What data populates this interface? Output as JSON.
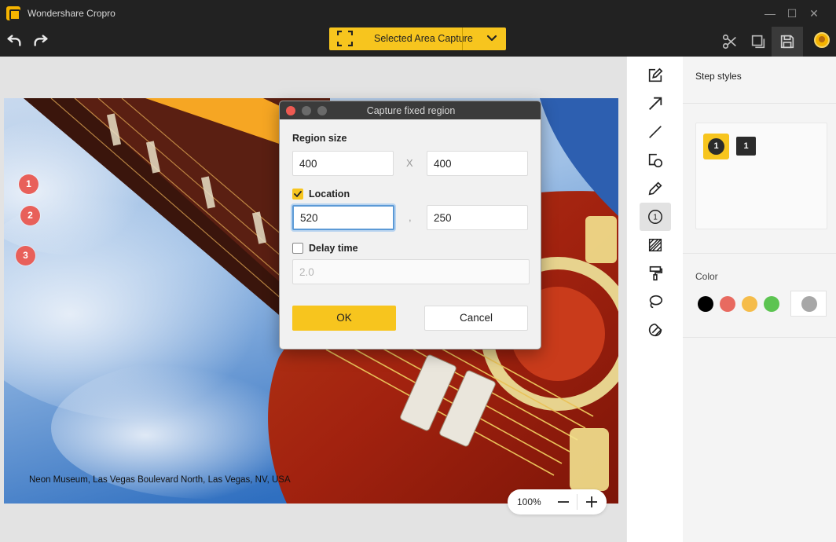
{
  "app": {
    "title": "Wondershare Cropro"
  },
  "window_controls": {
    "minimize": "—",
    "maximize": "☐",
    "close": "✕"
  },
  "toolbar": {
    "capture_mode": "Selected Area Capture",
    "icons": [
      "undo-icon",
      "redo-icon",
      "scissors-icon",
      "copy-icon",
      "save-icon"
    ]
  },
  "canvas": {
    "caption": "Neon Museum, Las Vegas Boulevard North, Las Vegas, NV, USA",
    "step_markers": [
      "1",
      "2",
      "3"
    ],
    "zoom": "100%"
  },
  "tools": [
    "edit-icon",
    "arrow-icon",
    "line-icon",
    "shape-icon",
    "pencil-icon",
    "step-icon",
    "mosaic-icon",
    "highlighter-icon",
    "lasso-icon",
    "eraser-icon"
  ],
  "step_tool_glyph": "1",
  "panel": {
    "step_styles_title": "Step styles",
    "style_circle_label": "1",
    "style_square_label": "1",
    "color_title": "Color",
    "colors": [
      "#000000",
      "#e86a60",
      "#f5bc4a",
      "#5cc451",
      "#a7a7a7"
    ]
  },
  "dialog": {
    "title": "Capture fixed region",
    "region_size_label": "Region size",
    "width": "400",
    "height": "400",
    "size_separator": "X",
    "location_label": "Location",
    "location_checked": true,
    "x": "520",
    "y": "250",
    "location_separator": ",",
    "delay_label": "Delay time",
    "delay_checked": false,
    "delay_value": "2.0",
    "ok": "OK",
    "cancel": "Cancel"
  },
  "accent_color": "#f7c51e"
}
